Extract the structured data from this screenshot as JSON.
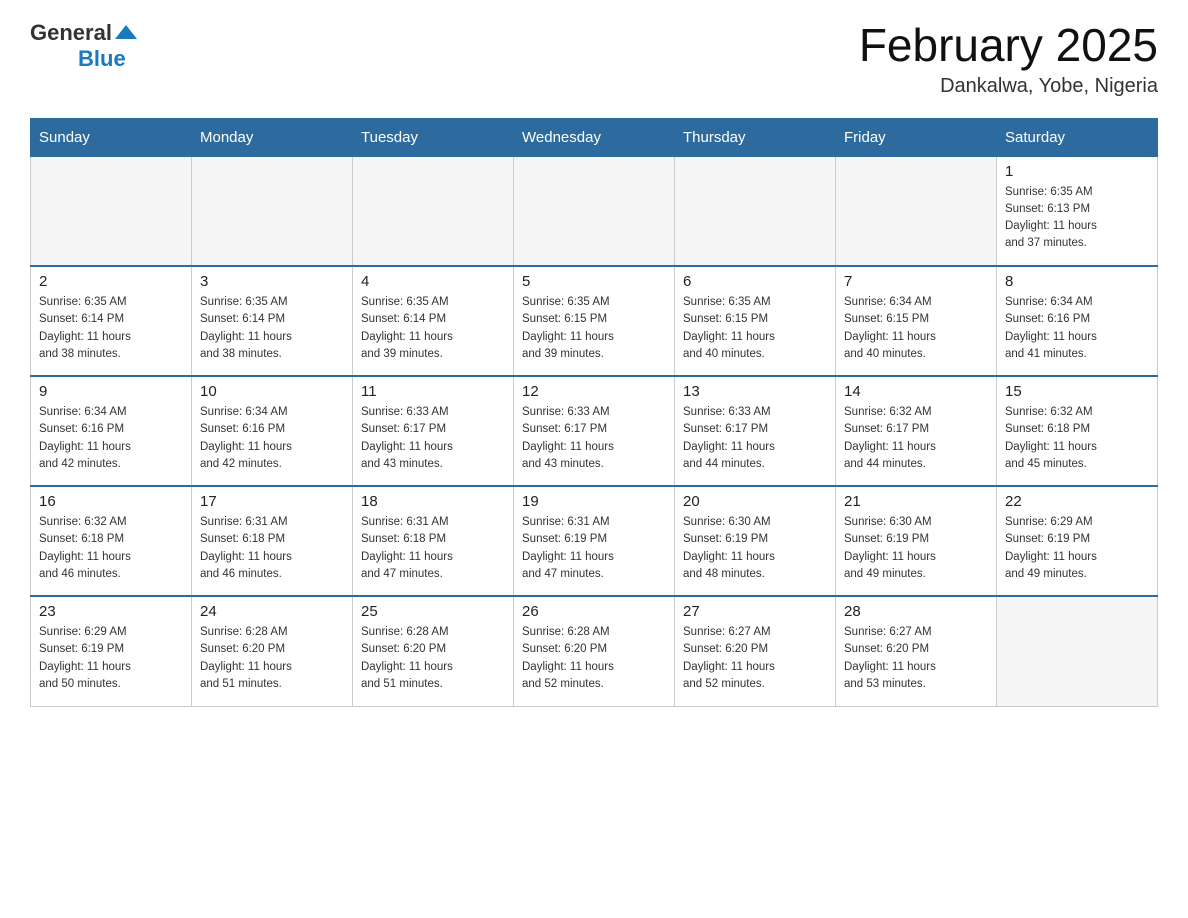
{
  "header": {
    "logo_general": "General",
    "logo_blue": "Blue",
    "title": "February 2025",
    "subtitle": "Dankalwa, Yobe, Nigeria"
  },
  "days_of_week": [
    "Sunday",
    "Monday",
    "Tuesday",
    "Wednesday",
    "Thursday",
    "Friday",
    "Saturday"
  ],
  "weeks": [
    [
      {
        "day": "",
        "info": ""
      },
      {
        "day": "",
        "info": ""
      },
      {
        "day": "",
        "info": ""
      },
      {
        "day": "",
        "info": ""
      },
      {
        "day": "",
        "info": ""
      },
      {
        "day": "",
        "info": ""
      },
      {
        "day": "1",
        "info": "Sunrise: 6:35 AM\nSunset: 6:13 PM\nDaylight: 11 hours\nand 37 minutes."
      }
    ],
    [
      {
        "day": "2",
        "info": "Sunrise: 6:35 AM\nSunset: 6:14 PM\nDaylight: 11 hours\nand 38 minutes."
      },
      {
        "day": "3",
        "info": "Sunrise: 6:35 AM\nSunset: 6:14 PM\nDaylight: 11 hours\nand 38 minutes."
      },
      {
        "day": "4",
        "info": "Sunrise: 6:35 AM\nSunset: 6:14 PM\nDaylight: 11 hours\nand 39 minutes."
      },
      {
        "day": "5",
        "info": "Sunrise: 6:35 AM\nSunset: 6:15 PM\nDaylight: 11 hours\nand 39 minutes."
      },
      {
        "day": "6",
        "info": "Sunrise: 6:35 AM\nSunset: 6:15 PM\nDaylight: 11 hours\nand 40 minutes."
      },
      {
        "day": "7",
        "info": "Sunrise: 6:34 AM\nSunset: 6:15 PM\nDaylight: 11 hours\nand 40 minutes."
      },
      {
        "day": "8",
        "info": "Sunrise: 6:34 AM\nSunset: 6:16 PM\nDaylight: 11 hours\nand 41 minutes."
      }
    ],
    [
      {
        "day": "9",
        "info": "Sunrise: 6:34 AM\nSunset: 6:16 PM\nDaylight: 11 hours\nand 42 minutes."
      },
      {
        "day": "10",
        "info": "Sunrise: 6:34 AM\nSunset: 6:16 PM\nDaylight: 11 hours\nand 42 minutes."
      },
      {
        "day": "11",
        "info": "Sunrise: 6:33 AM\nSunset: 6:17 PM\nDaylight: 11 hours\nand 43 minutes."
      },
      {
        "day": "12",
        "info": "Sunrise: 6:33 AM\nSunset: 6:17 PM\nDaylight: 11 hours\nand 43 minutes."
      },
      {
        "day": "13",
        "info": "Sunrise: 6:33 AM\nSunset: 6:17 PM\nDaylight: 11 hours\nand 44 minutes."
      },
      {
        "day": "14",
        "info": "Sunrise: 6:32 AM\nSunset: 6:17 PM\nDaylight: 11 hours\nand 44 minutes."
      },
      {
        "day": "15",
        "info": "Sunrise: 6:32 AM\nSunset: 6:18 PM\nDaylight: 11 hours\nand 45 minutes."
      }
    ],
    [
      {
        "day": "16",
        "info": "Sunrise: 6:32 AM\nSunset: 6:18 PM\nDaylight: 11 hours\nand 46 minutes."
      },
      {
        "day": "17",
        "info": "Sunrise: 6:31 AM\nSunset: 6:18 PM\nDaylight: 11 hours\nand 46 minutes."
      },
      {
        "day": "18",
        "info": "Sunrise: 6:31 AM\nSunset: 6:18 PM\nDaylight: 11 hours\nand 47 minutes."
      },
      {
        "day": "19",
        "info": "Sunrise: 6:31 AM\nSunset: 6:19 PM\nDaylight: 11 hours\nand 47 minutes."
      },
      {
        "day": "20",
        "info": "Sunrise: 6:30 AM\nSunset: 6:19 PM\nDaylight: 11 hours\nand 48 minutes."
      },
      {
        "day": "21",
        "info": "Sunrise: 6:30 AM\nSunset: 6:19 PM\nDaylight: 11 hours\nand 49 minutes."
      },
      {
        "day": "22",
        "info": "Sunrise: 6:29 AM\nSunset: 6:19 PM\nDaylight: 11 hours\nand 49 minutes."
      }
    ],
    [
      {
        "day": "23",
        "info": "Sunrise: 6:29 AM\nSunset: 6:19 PM\nDaylight: 11 hours\nand 50 minutes."
      },
      {
        "day": "24",
        "info": "Sunrise: 6:28 AM\nSunset: 6:20 PM\nDaylight: 11 hours\nand 51 minutes."
      },
      {
        "day": "25",
        "info": "Sunrise: 6:28 AM\nSunset: 6:20 PM\nDaylight: 11 hours\nand 51 minutes."
      },
      {
        "day": "26",
        "info": "Sunrise: 6:28 AM\nSunset: 6:20 PM\nDaylight: 11 hours\nand 52 minutes."
      },
      {
        "day": "27",
        "info": "Sunrise: 6:27 AM\nSunset: 6:20 PM\nDaylight: 11 hours\nand 52 minutes."
      },
      {
        "day": "28",
        "info": "Sunrise: 6:27 AM\nSunset: 6:20 PM\nDaylight: 11 hours\nand 53 minutes."
      },
      {
        "day": "",
        "info": ""
      }
    ]
  ]
}
